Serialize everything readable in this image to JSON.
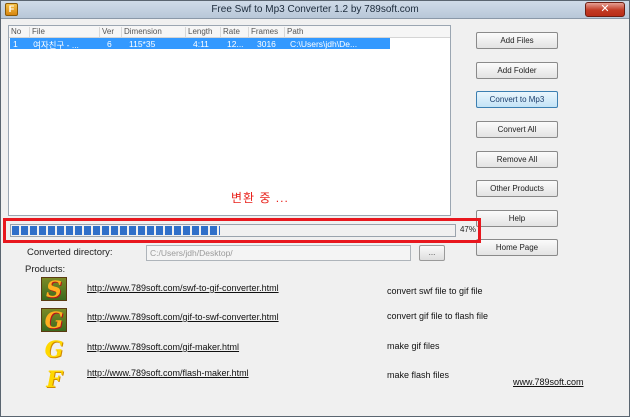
{
  "window": {
    "title": "Free Swf to Mp3 Converter 1.2 by 789soft.com",
    "close_glyph": "✕",
    "app_icon_glyph": "F"
  },
  "file_list": {
    "columns": [
      "No",
      "File",
      "Ver",
      "Dimension",
      "Length",
      "Rate",
      "Frames",
      "Path"
    ],
    "rows": [
      {
        "no": "1",
        "file": "여자친구 - ...",
        "ver": "6",
        "dimension": "115*35",
        "length": "4:11",
        "rate": "12...",
        "frames": "3016",
        "path": "C:\\Users\\jdh\\De..."
      }
    ]
  },
  "buttons": {
    "add_files": "Add Files",
    "add_folder": "Add Folder",
    "convert_to_mp3": "Convert to Mp3",
    "convert_all": "Convert All",
    "remove_all": "Remove All",
    "other_products": "Other Products",
    "help": "Help",
    "home_page": "Home Page"
  },
  "status": {
    "text": "변환 중 ...",
    "progress_percent": 47,
    "progress_label": "47%"
  },
  "output": {
    "converted_directory_label": "Converted directory:",
    "directory_value": "C:/Users/jdh/Desktop/",
    "browse_label": "..."
  },
  "products": {
    "label": "Products:",
    "items": [
      {
        "icon": "S",
        "link": "http://www.789soft.com/swf-to-gif-converter.html",
        "desc": "convert swf file to gif file"
      },
      {
        "icon": "G",
        "link": "http://www.789soft.com/gif-to-swf-converter.html",
        "desc": "convert gif file to flash file"
      },
      {
        "icon": "G",
        "link": "http://www.789soft.com/gif-maker.html",
        "desc": "make gif files"
      },
      {
        "icon": "F",
        "link": "http://www.789soft.com/flash-maker.html",
        "desc": "make flash files"
      }
    ],
    "site_link": "www.789soft.com"
  },
  "colors": {
    "selection": "#3399ff",
    "progress_segment": "#2f6fc9",
    "highlight_frame": "#e8171e",
    "status_text": "#e8201a"
  }
}
